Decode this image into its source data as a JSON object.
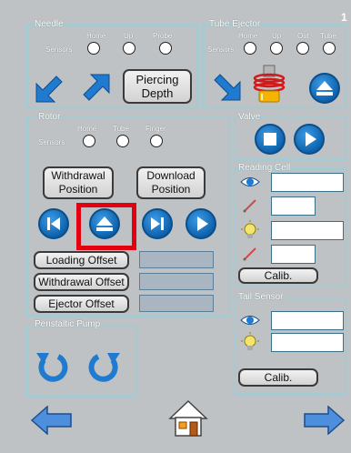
{
  "page_number": "1",
  "colors": {
    "panel_border": "#a7c9cf",
    "button_blue": "#1a78c9",
    "highlight": "#e3000f",
    "background": "#bfc2c5"
  },
  "needle": {
    "title": "Needle",
    "sensors_label": "Sensors",
    "sensor_labels": [
      "Home",
      "Up",
      "Probe"
    ],
    "piercing_depth_label": "Piercing\nDepth"
  },
  "tube_ejector": {
    "title": "Tube Ejector",
    "sensors_label": "Sensors",
    "sensor_labels": [
      "Home",
      "Up",
      "Out",
      "Tube"
    ]
  },
  "rotor": {
    "title": "Rotor",
    "sensors_label": "Sensors",
    "sensor_labels": [
      "Home",
      "Tube",
      "Finger"
    ],
    "withdrawal_position_label": "Withdrawal\nPosition",
    "download_position_label": "Download\nPosition",
    "loading_offset_label": "Loading Offset",
    "withdrawal_offset_label": "Withdrawal Offset",
    "ejector_offset_label": "Ejector Offset"
  },
  "valve": {
    "title": "Valve"
  },
  "reading_cell": {
    "title": "Reading Cell",
    "calib_label": "Calib."
  },
  "tail_sensor": {
    "title": "Tail Sensor",
    "calib_label": "Calib."
  },
  "peristaltic_pump": {
    "title": "Peristaltic Pump"
  },
  "icons": [
    "arrow-down-left-icon",
    "arrow-up-right-icon",
    "arrow-down-right-icon",
    "spring-icon",
    "eject-icon",
    "stop-icon",
    "play-icon",
    "skip-back-icon",
    "skip-forward-icon",
    "eye-icon",
    "pipette-icon",
    "bulb-icon",
    "rotate-ccw-icon",
    "rotate-cw-icon",
    "home-icon",
    "arrow-left-icon",
    "arrow-right-icon"
  ]
}
